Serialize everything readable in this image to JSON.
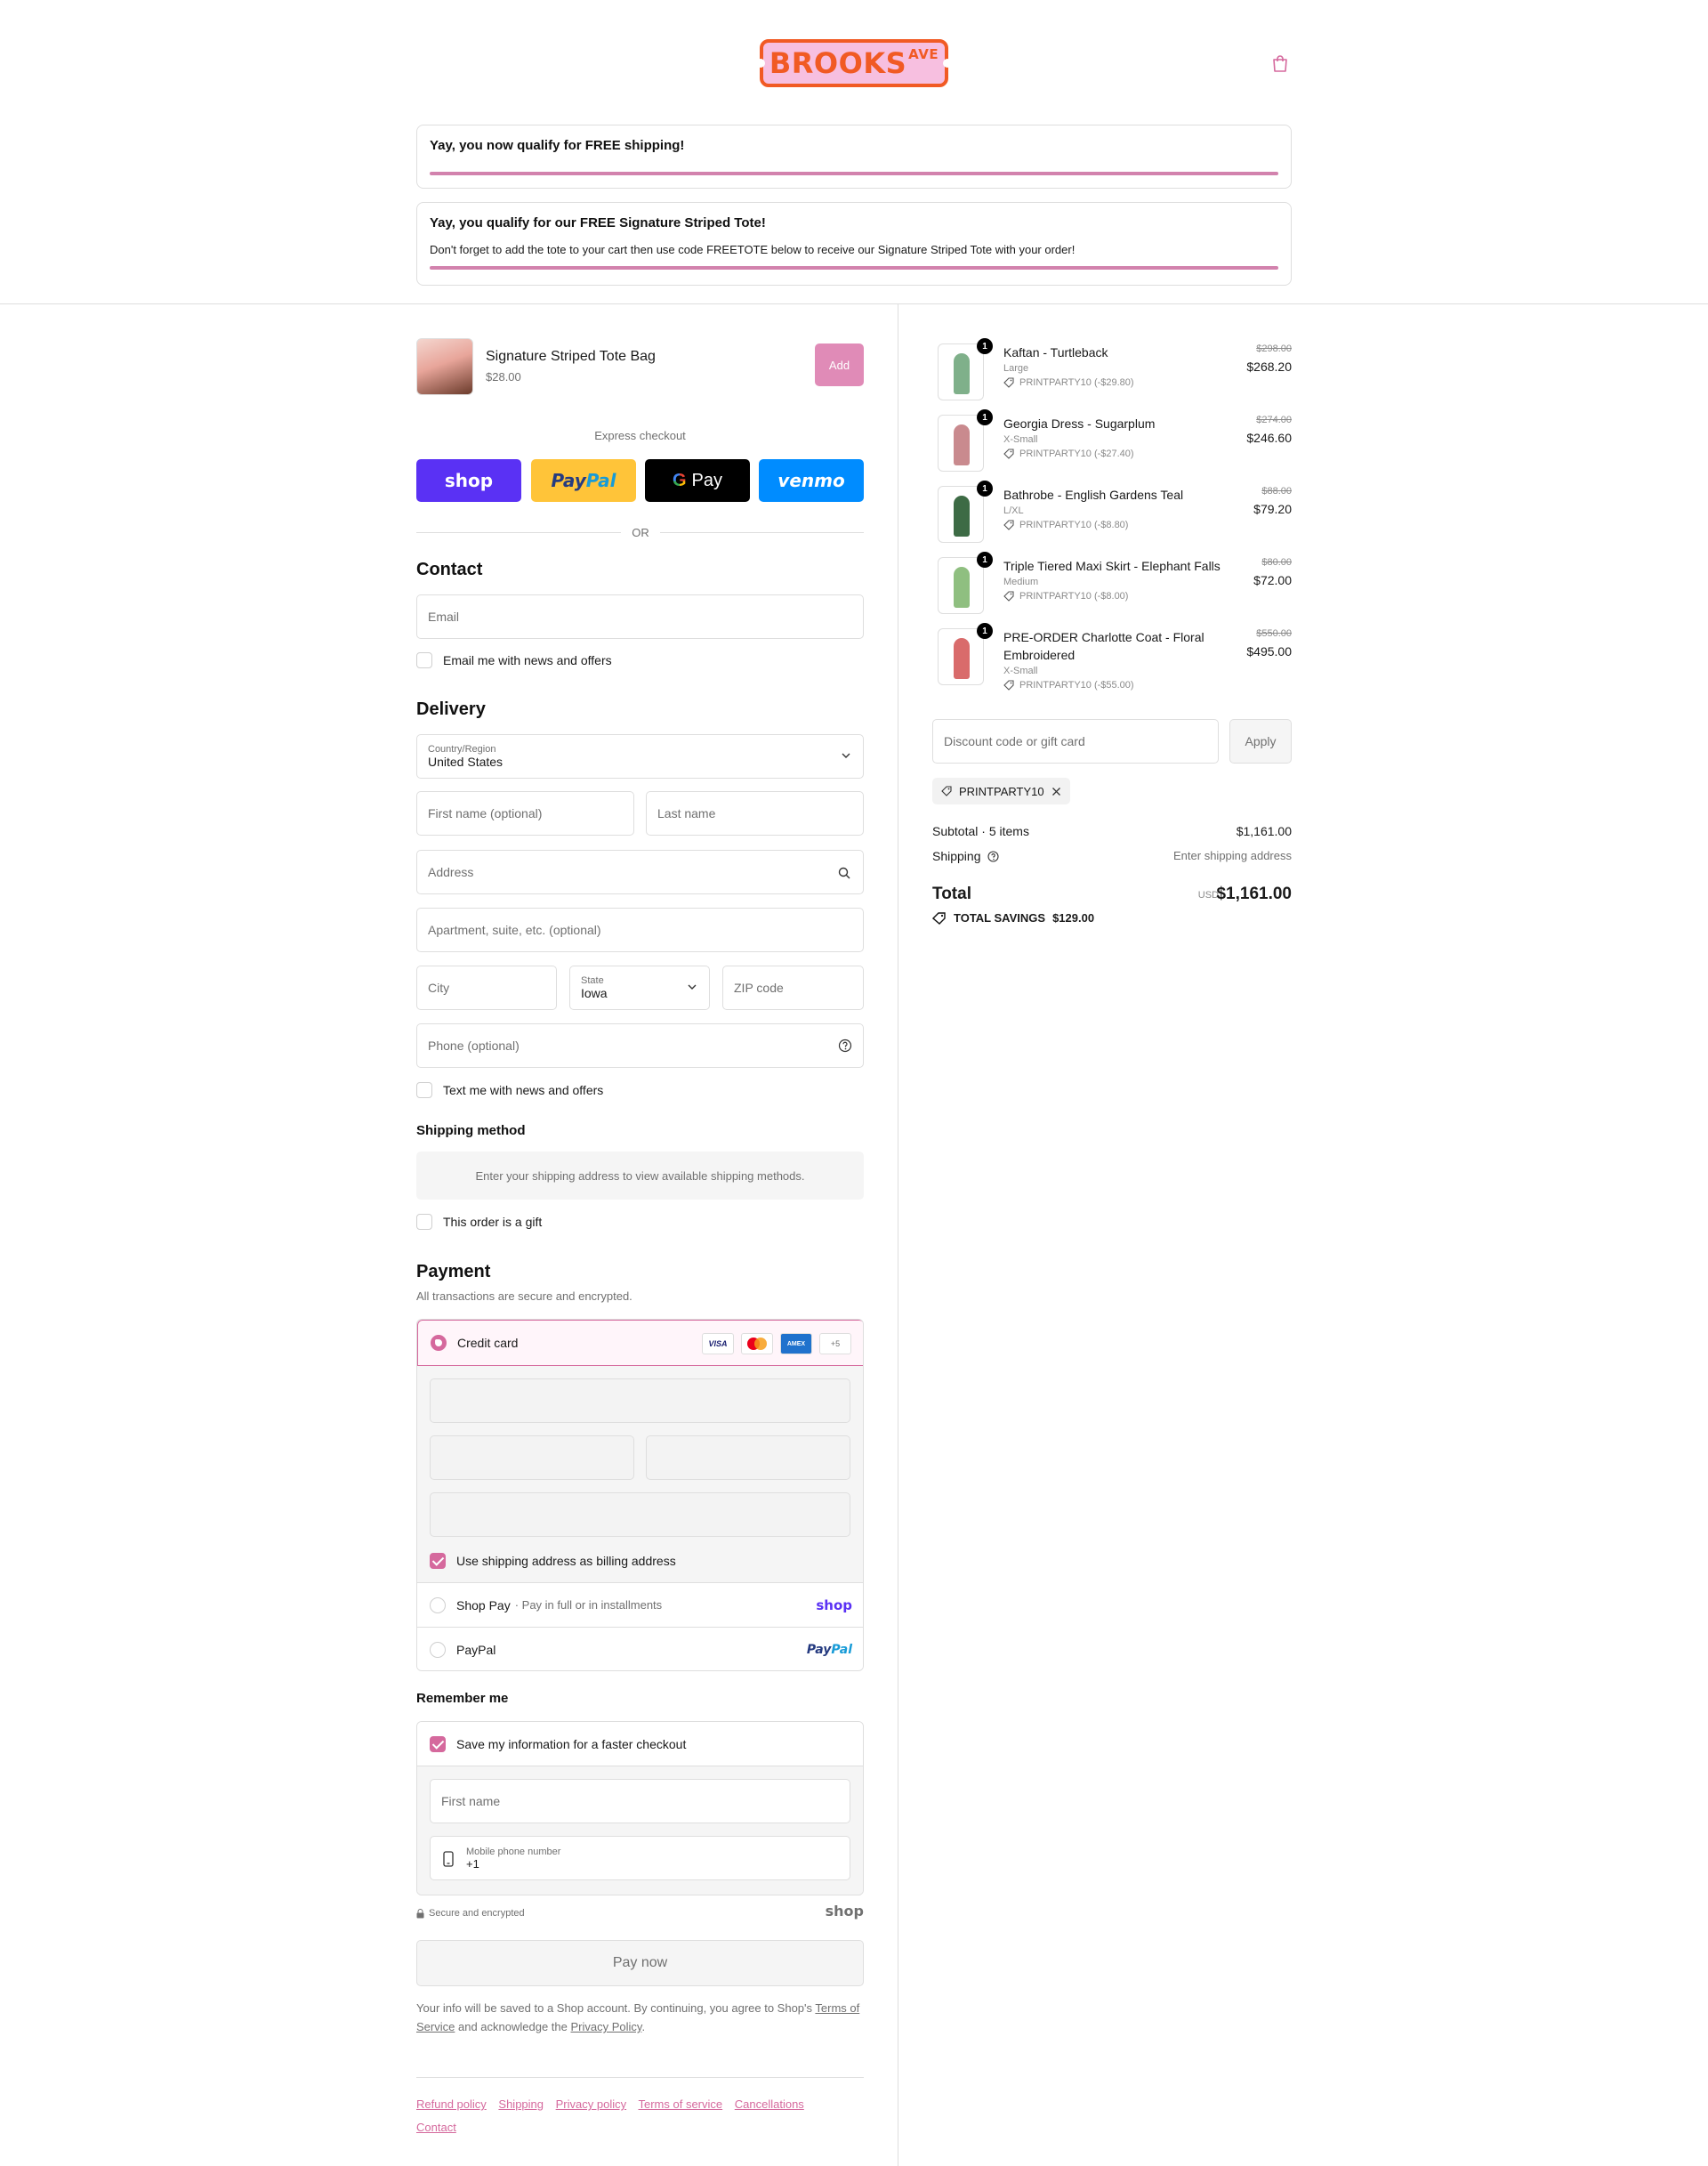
{
  "header": {
    "logo_text": "BROOKS",
    "logo_sup": "AVE",
    "banner_shipping": "Yay, you now qualify for FREE shipping!",
    "banner_tote_title": "Yay, you qualify for our FREE Signature Striped Tote!",
    "banner_tote_text": "Don't forget to add the tote to your cart then use code FREETOTE below to receive our Signature Striped Tote with your order!",
    "shipping_progress": 1.0,
    "tote_progress": 1.0
  },
  "upsell": {
    "name": "Signature Striped Tote Bag",
    "price": "$28.00",
    "add_label": "Add"
  },
  "express": {
    "label": "Express checkout",
    "shop": "shop",
    "paypal_a": "Pay",
    "paypal_b": "Pal",
    "gpay_g": "G",
    "gpay": "Pay",
    "venmo": "venmo",
    "or": "OR"
  },
  "contact": {
    "title": "Contact",
    "email_placeholder": "Email",
    "news_label": "Email me with news and offers"
  },
  "delivery": {
    "title": "Delivery",
    "country_label": "Country/Region",
    "country_value": "United States",
    "first_name": "First name (optional)",
    "last_name": "Last name",
    "address": "Address",
    "apartment": "Apartment, suite, etc. (optional)",
    "city": "City",
    "state_label": "State",
    "state_value": "Iowa",
    "zip": "ZIP code",
    "phone": "Phone (optional)",
    "text_label": "Text me with news and offers"
  },
  "shipping_method": {
    "title": "Shipping method",
    "message": "Enter your shipping address to view available shipping methods.",
    "gift_label": "This order is a gift"
  },
  "payment": {
    "title": "Payment",
    "subtitle": "All transactions are secure and encrypted.",
    "credit_card": "Credit card",
    "card_visa": "VISA",
    "card_amex": "AMEX",
    "card_more": "+5",
    "billing_label": "Use shipping address as billing address",
    "shop_pay": "Shop Pay",
    "shop_pay_note": "· Pay in full or in installments",
    "shop_pay_brand": "shop",
    "paypal": "PayPal",
    "paypal_brand_a": "Pay",
    "paypal_brand_b": "Pal"
  },
  "remember": {
    "title": "Remember me",
    "save_label": "Save my information for a faster checkout",
    "first_name": "First name",
    "mobile_label": "Mobile phone number",
    "mobile_value": "+1",
    "secure": "Secure and encrypted",
    "shop_brand": "shop"
  },
  "pay_now": "Pay now",
  "legal": {
    "text_1": "Your info will be saved to a Shop account. By continuing, you agree to Shop's",
    "terms": "Terms of Service",
    "text_2": "and acknowledge the",
    "privacy": "Privacy Policy",
    "text_3": "."
  },
  "footer": {
    "links": [
      "Refund policy",
      "Shipping",
      "Privacy policy",
      "Terms of service",
      "Cancellations",
      "Contact"
    ]
  },
  "cart": {
    "items": [
      {
        "name": "Kaftan - Turtleback",
        "variant": "Large",
        "discount": "PRINTPARTY10 (-$29.80)",
        "old_price": "$298.00",
        "price": "$268.20",
        "qty": "1",
        "color": "#7fb08a"
      },
      {
        "name": "Georgia Dress - Sugarplum",
        "variant": "X-Small",
        "discount": "PRINTPARTY10 (-$27.40)",
        "old_price": "$274.00",
        "price": "$246.60",
        "qty": "1",
        "color": "#c98a8e"
      },
      {
        "name": "Bathrobe - English Gardens Teal",
        "variant": "L/XL",
        "discount": "PRINTPARTY10 (-$8.80)",
        "old_price": "$88.00",
        "price": "$79.20",
        "qty": "1",
        "color": "#3d6b45"
      },
      {
        "name": "Triple Tiered Maxi Skirt - Elephant Falls",
        "variant": "Medium",
        "discount": "PRINTPARTY10 (-$8.00)",
        "old_price": "$80.00",
        "price": "$72.00",
        "qty": "1",
        "color": "#8fbf80"
      },
      {
        "name": "PRE-ORDER Charlotte Coat - Floral Embroidered",
        "variant": "X-Small",
        "discount": "PRINTPARTY10 (-$55.00)",
        "old_price": "$550.00",
        "price": "$495.00",
        "qty": "1",
        "color": "#d96b6b"
      }
    ],
    "discount_placeholder": "Discount code or gift card",
    "apply": "Apply",
    "applied_code": "PRINTPARTY10",
    "subtotal_label": "Subtotal · 5 items",
    "subtotal_value": "$1,161.00",
    "shipping_label": "Shipping",
    "shipping_value": "Enter shipping address",
    "total_label": "Total",
    "currency": "USD",
    "total_value": "$1,161.00",
    "savings_label": "TOTAL SAVINGS",
    "savings_value": "$129.00"
  },
  "colors": {
    "accent": "#d5699d",
    "progress": "#d282ad",
    "logo_orange": "#f15a24",
    "logo_pink": "#f7bfe0",
    "shop_purple": "#5a31f4"
  }
}
